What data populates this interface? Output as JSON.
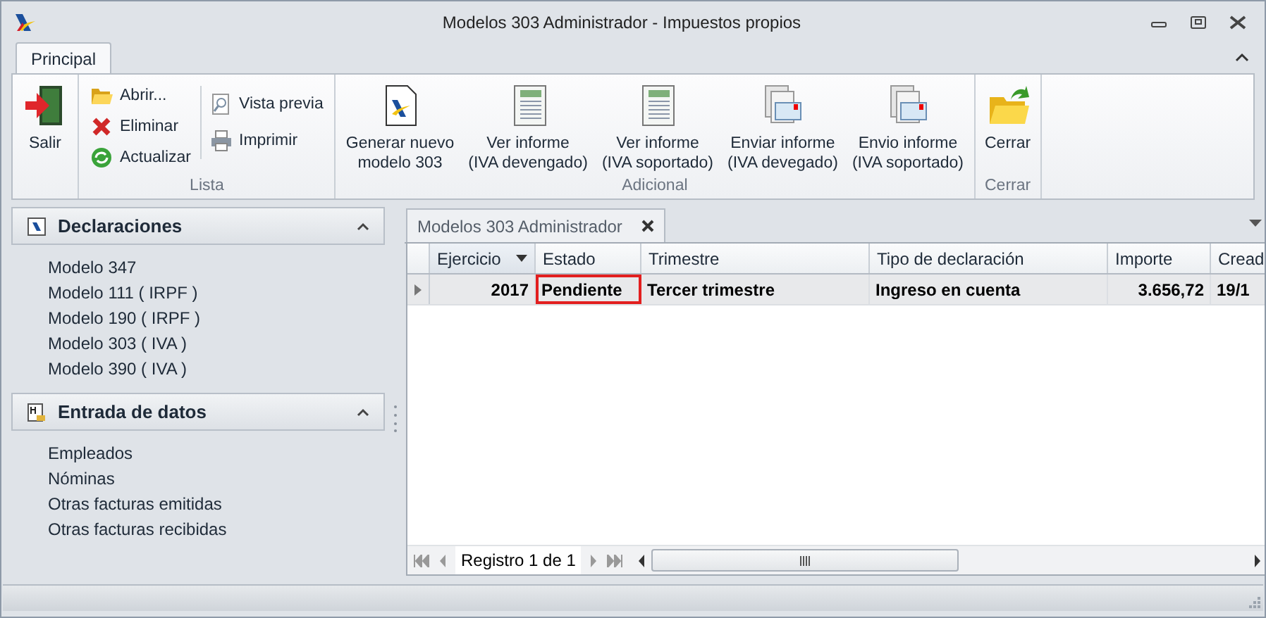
{
  "window": {
    "title": "Modelos 303 Administrador - Impuestos propios"
  },
  "ribbon_tabs": [
    {
      "label": "Principal",
      "selected": true
    }
  ],
  "ribbon_groups": [
    {
      "columns": [
        [
          {
            "label": "Salir",
            "kind": "large"
          }
        ]
      ]
    },
    {
      "label": "Lista",
      "columns": [
        [
          {
            "label": "Abrir...",
            "kind": "small"
          },
          {
            "label": "Eliminar",
            "kind": "small"
          },
          {
            "label": "Actualizar",
            "kind": "small"
          }
        ],
        [
          {
            "label": "Vista previa",
            "kind": "small"
          },
          {
            "label": "Imprimir",
            "kind": "small"
          }
        ]
      ]
    },
    {
      "label": "Adicional",
      "columns": [
        [
          {
            "label": "Generar nuevo\nmodelo 303",
            "kind": "large"
          }
        ],
        [
          {
            "label": "Ver informe\n(IVA devengado)",
            "kind": "large"
          }
        ],
        [
          {
            "label": "Ver informe\n(IVA soportado)",
            "kind": "large"
          }
        ],
        [
          {
            "label": "Enviar informe\n(IVA devegado)",
            "kind": "large"
          }
        ],
        [
          {
            "label": "Envio informe\n(IVA soportado)",
            "kind": "large"
          }
        ]
      ]
    },
    {
      "label": "Cerrar",
      "columns": [
        [
          {
            "label": "Cerrar",
            "kind": "large"
          }
        ]
      ]
    }
  ],
  "nav_groups": [
    {
      "title": "Declaraciones",
      "expanded": true,
      "items": [
        "Modelo 347",
        "Modelo 111 ( IRPF )",
        "Modelo 190 ( IRPF )",
        "Modelo 303 ( IVA )",
        "Modelo 390 ( IVA )"
      ]
    },
    {
      "title": "Entrada de datos",
      "expanded": true,
      "items": [
        "Empleados",
        "Nóminas",
        "Otras facturas emitidas",
        "Otras facturas recibidas"
      ]
    }
  ],
  "document_tabs": [
    {
      "label": "Modelos 303 Administrador",
      "selected": true
    }
  ],
  "grid": {
    "columns": [
      {
        "label": "Ejercicio",
        "filter": true
      },
      {
        "label": "Estado",
        "filter": false
      },
      {
        "label": "Trimestre",
        "filter": false
      },
      {
        "label": "Tipo de declaración",
        "filter": false
      },
      {
        "label": "Importe",
        "filter": false
      },
      {
        "label": "Cread",
        "filter": false
      }
    ],
    "rows": [
      {
        "current": true,
        "cells": [
          {
            "text": "2017",
            "focused": false
          },
          {
            "text": "Pendiente",
            "focused": true
          },
          {
            "text": "Tercer trimestre",
            "focused": false
          },
          {
            "text": "Ingreso en cuenta",
            "focused": false
          },
          {
            "text": "3.656,72",
            "focused": false
          },
          {
            "text": "19/1",
            "focused": false
          }
        ]
      }
    ],
    "navigator": "Registro 1 de 1"
  }
}
